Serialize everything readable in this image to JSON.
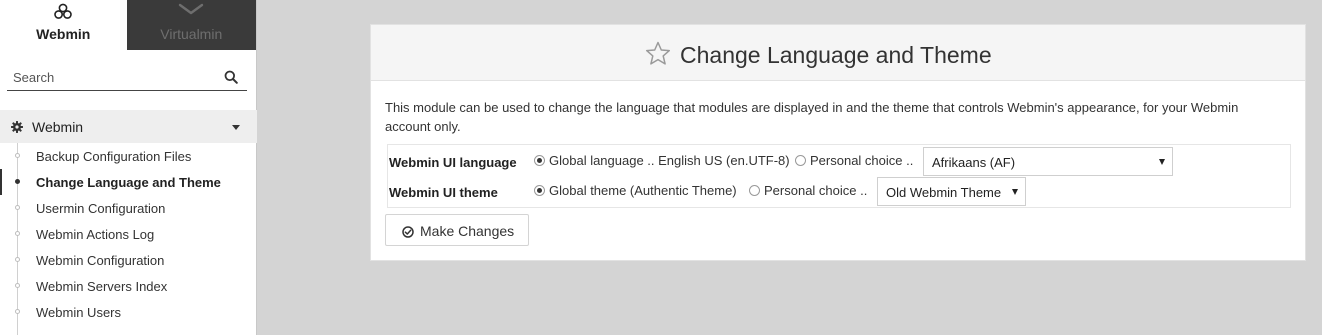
{
  "switcher": {
    "webmin_label": "Webmin",
    "virtualmin_label": "Virtualmin"
  },
  "search": {
    "placeholder": "Search"
  },
  "sidebar": {
    "category_label": "Webmin",
    "items": [
      {
        "label": "Backup Configuration Files",
        "active": false
      },
      {
        "label": "Change Language and Theme",
        "active": true
      },
      {
        "label": "Usermin Configuration",
        "active": false
      },
      {
        "label": "Webmin Actions Log",
        "active": false
      },
      {
        "label": "Webmin Configuration",
        "active": false
      },
      {
        "label": "Webmin Servers Index",
        "active": false
      },
      {
        "label": "Webmin Users",
        "active": false
      }
    ]
  },
  "page": {
    "title": "Change Language and Theme",
    "description": "This module can be used to change the language that modules are displayed in and the theme that controls Webmin's appearance, for your Webmin account only."
  },
  "form": {
    "language": {
      "label": "Webmin UI language",
      "global_option": "Global language .. English US (en.UTF-8)",
      "personal_option": "Personal choice ..",
      "selected": "Afrikaans (AF)",
      "mode": "global"
    },
    "theme": {
      "label": "Webmin UI theme",
      "global_option": "Global theme (Authentic Theme)",
      "personal_option": "Personal choice ..",
      "selected": "Old Webmin Theme",
      "mode": "global"
    },
    "submit_label": "Make Changes"
  },
  "colors": {
    "sidebar_dark_tab": "#3a3a3a",
    "page_background": "#d4d4d4",
    "panel_header": "#f5f5f5"
  }
}
